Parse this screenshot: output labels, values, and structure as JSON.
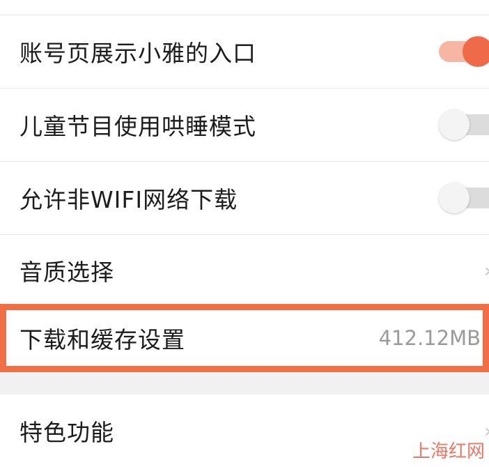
{
  "settings": {
    "rows": [
      {
        "label": "账号页展示小雅的入口",
        "control": "toggle",
        "state": "on"
      },
      {
        "label": "儿童节目使用哄睡模式",
        "control": "toggle",
        "state": "off"
      },
      {
        "label": "允许非WIFI网络下载",
        "control": "toggle",
        "state": "off"
      },
      {
        "label": "音质选择",
        "control": "chevron"
      },
      {
        "label": "下载和缓存设置",
        "control": "value-chevron",
        "value": "412.12MB"
      },
      {
        "label": "特色功能",
        "control": "chevron"
      }
    ]
  },
  "icons": {
    "chevron": "chevron-right-icon"
  },
  "colors": {
    "accent": "#ee6a48",
    "toggle_on_track": "#f7b5a4",
    "highlight_frame": "#f26e44",
    "watermark": "#e8604a"
  },
  "watermark": {
    "text": "上海红网"
  }
}
